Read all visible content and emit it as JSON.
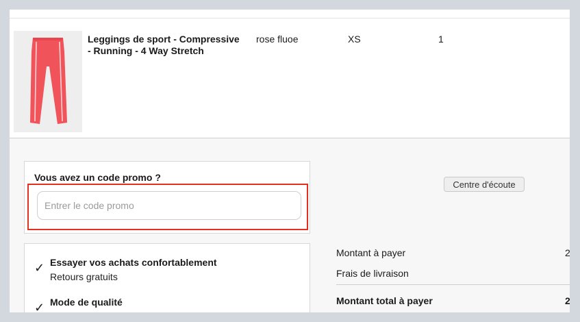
{
  "product": {
    "name": "Leggings de sport - Compressive - Running - 4 Way Stretch",
    "color": "rose fluoe",
    "size": "XS",
    "quantity": "1",
    "image_color": "#f0535a"
  },
  "promo": {
    "title": "Vous avez un code promo ?",
    "placeholder": "Entrer le code promo"
  },
  "benefits": [
    {
      "title": "Essayer vos achats confortablement",
      "subtitle": "Retours gratuits"
    },
    {
      "title": "Mode de qualité",
      "subtitle": ""
    }
  ],
  "summary": {
    "amount_label": "Montant à payer",
    "amount_value": "2",
    "shipping_label": "Frais de livraison",
    "total_label": "Montant total à payer",
    "total_value": "2"
  },
  "floating_button_label": "Centre d'écoute",
  "colors": {
    "highlight": "#e0301e",
    "background": "#d3d8de"
  }
}
